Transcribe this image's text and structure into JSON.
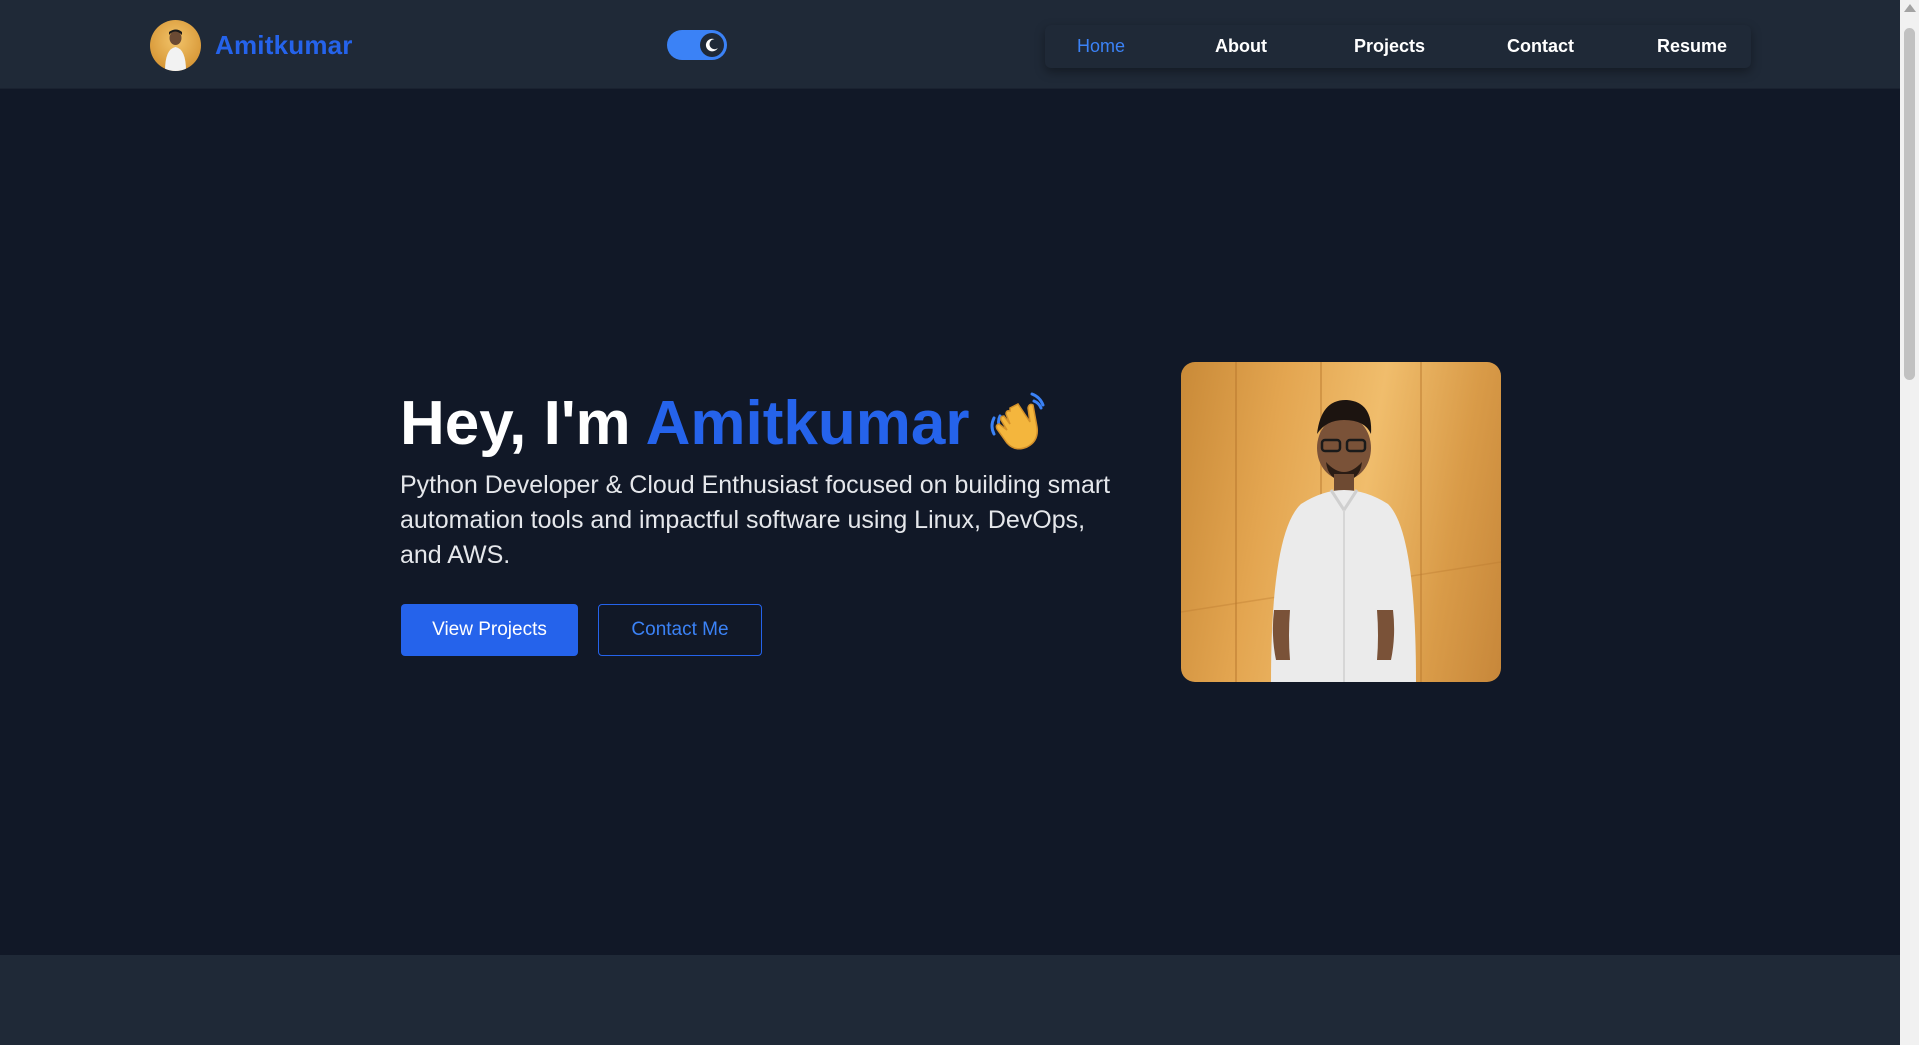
{
  "header": {
    "brand_name": "Amitkumar",
    "nav": [
      {
        "label": "Home",
        "active": true
      },
      {
        "label": "About",
        "active": false
      },
      {
        "label": "Projects",
        "active": false
      },
      {
        "label": "Contact",
        "active": false
      },
      {
        "label": "Resume",
        "active": false
      }
    ],
    "theme_toggle": {
      "state": "dark",
      "icon": "moon-icon"
    }
  },
  "hero": {
    "greeting": "Hey, I'm",
    "name": "Amitkumar",
    "emoji": "wave-icon",
    "description": "Python Developer & Cloud Enthusiast focused on building smart automation tools and impactful software using Linux, DevOps, and AWS.",
    "primary_button": "View Projects",
    "secondary_button": "Contact Me"
  },
  "colors": {
    "page_bg": "#111827",
    "header_bg": "#1f2937",
    "accent": "#2563eb",
    "text": "#ffffff"
  }
}
